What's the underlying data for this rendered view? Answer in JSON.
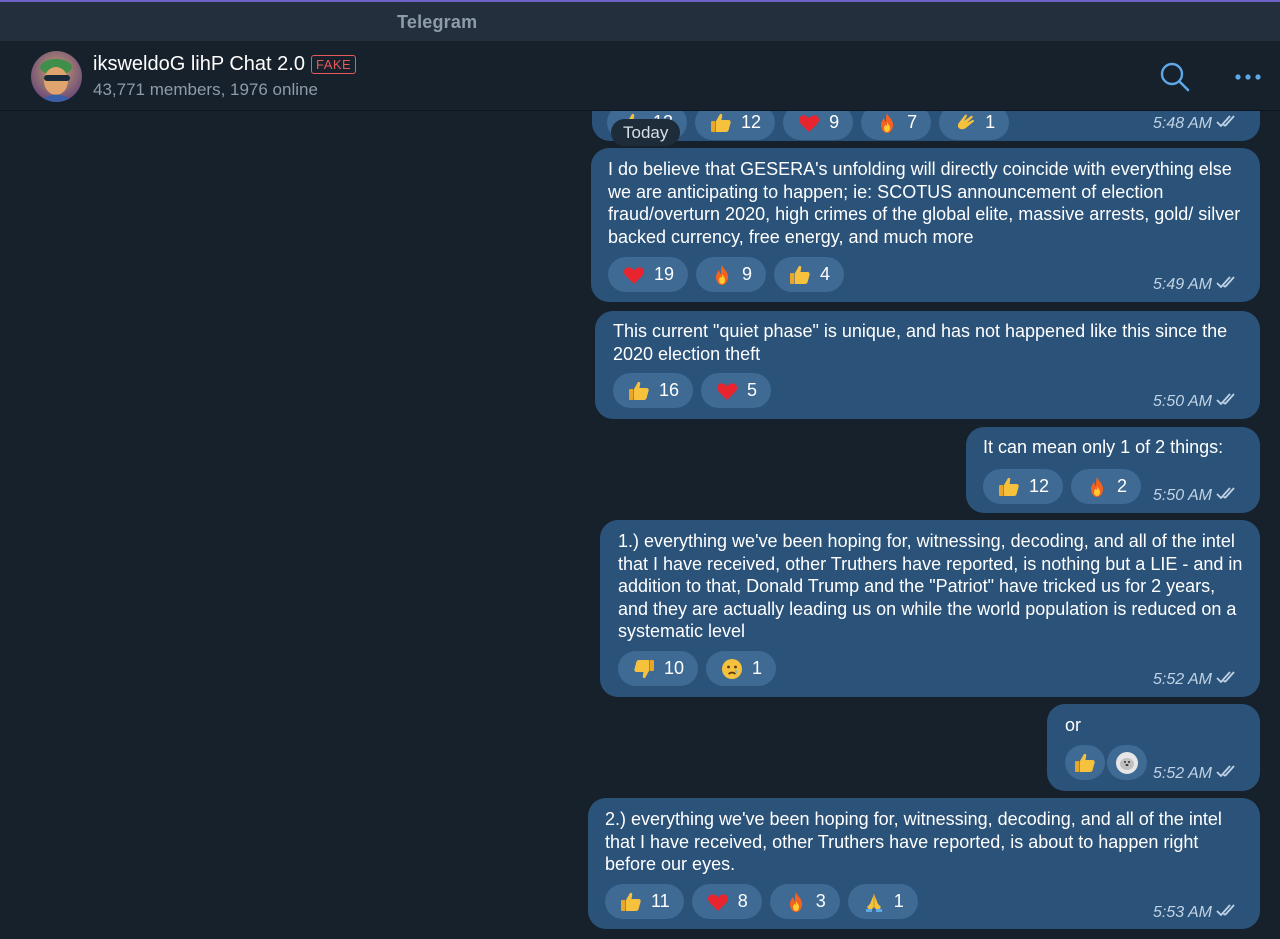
{
  "window": {
    "title": "Telegram"
  },
  "chat": {
    "name": "iksweldoG lihP Chat 2.0",
    "badge": "FAKE",
    "subtitle": "43,771 members, 1976 online"
  },
  "date_separator": "Today",
  "colors": {
    "background": "#17212b",
    "bubble": "#2b5278",
    "reaction": "#3e6a94",
    "fake_badge": "#e55a5a",
    "accent": "#5fa8e8"
  },
  "messages": [
    {
      "text": "",
      "time": "5:48 AM",
      "reactions": [
        {
          "emoji": "thumbs-up",
          "count": "13"
        },
        {
          "emoji": "thumbs-up",
          "count": "12"
        },
        {
          "emoji": "heart",
          "count": "9"
        },
        {
          "emoji": "fire",
          "count": "7"
        },
        {
          "emoji": "clapping",
          "count": "1"
        }
      ]
    },
    {
      "text": "I do believe that GESERA's unfolding will directly coincide with everything else we are anticipating to happen; ie: SCOTUS announcement of election fraud/overturn 2020, high crimes of the global elite, massive arrests, gold/ silver backed currency, free energy, and much more",
      "time": "5:49 AM",
      "reactions": [
        {
          "emoji": "heart",
          "count": "19"
        },
        {
          "emoji": "fire",
          "count": "9"
        },
        {
          "emoji": "thumbs-up",
          "count": "4"
        }
      ]
    },
    {
      "text": "This current \"quiet phase\" is unique, and has not happened like this since the 2020 election theft",
      "time": "5:50 AM",
      "reactions": [
        {
          "emoji": "thumbs-up",
          "count": "16"
        },
        {
          "emoji": "heart",
          "count": "5"
        }
      ]
    },
    {
      "text": "It can mean only 1 of 2 things:",
      "time": "5:50 AM",
      "reactions": [
        {
          "emoji": "thumbs-up",
          "count": "12"
        },
        {
          "emoji": "fire",
          "count": "2"
        }
      ]
    },
    {
      "text": "1.) everything we've been hoping for, witnessing, decoding, and all of the intel that I have received, other Truthers have reported, is nothing but a LIE - and in addition to that, Donald Trump and the \"Patriot\" have tricked us for 2 years, and they are actually leading us on while the world population is reduced on a systematic level",
      "time": "5:52 AM",
      "reactions": [
        {
          "emoji": "thumbs-down",
          "count": "10"
        },
        {
          "emoji": "crying-face",
          "count": "1"
        }
      ]
    },
    {
      "text": "or",
      "time": "5:52 AM",
      "reactions": [
        {
          "emoji": "thumbs-up",
          "count": ""
        },
        {
          "emoji": "user-avatar",
          "count": ""
        }
      ]
    },
    {
      "text": "2.) everything we've been hoping for, witnessing, decoding, and all of the intel that I have received, other Truthers have reported, is about to happen right before our eyes.",
      "time": "5:53 AM",
      "reactions": [
        {
          "emoji": "thumbs-up",
          "count": "11"
        },
        {
          "emoji": "heart",
          "count": "8"
        },
        {
          "emoji": "fire",
          "count": "3"
        },
        {
          "emoji": "folded-hands",
          "count": "1"
        }
      ]
    }
  ]
}
